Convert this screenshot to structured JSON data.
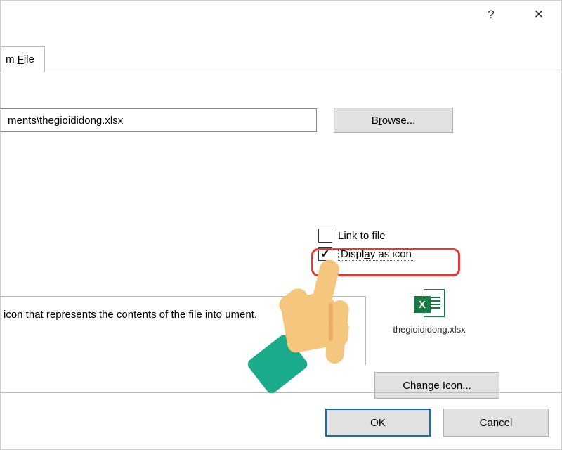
{
  "titlebar": {
    "help_label": "?",
    "close_label": "✕"
  },
  "tab": {
    "label_prefix": "m ",
    "label_mnemonic": "F",
    "label_suffix": "ile"
  },
  "file": {
    "path_value": "ments\\thegioididong.xlsx",
    "browse_prefix": "B",
    "browse_mnemonic": "r",
    "browse_suffix": "owse..."
  },
  "options": {
    "link_label": "Link to file",
    "link_checked": false,
    "display_prefix": "Displ",
    "display_mnemonic": "a",
    "display_suffix": "y as icon",
    "display_checked": true
  },
  "description": {
    "text": "icon that represents the contents of the file into ument."
  },
  "preview": {
    "icon_letter": "X",
    "caption": "thegioididong.xlsx"
  },
  "change_icon": {
    "prefix": "Change ",
    "mnemonic": "I",
    "suffix": "con..."
  },
  "buttons": {
    "ok": "OK",
    "cancel": "Cancel"
  }
}
